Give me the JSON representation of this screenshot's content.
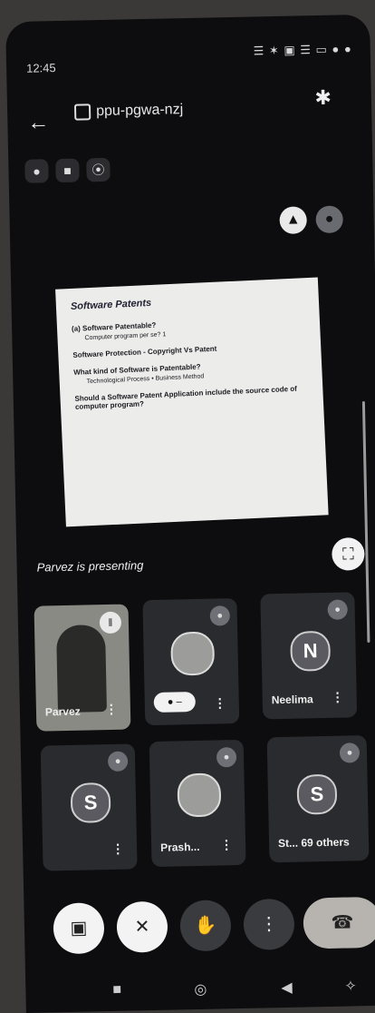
{
  "status": {
    "time": "12:45",
    "right_icons": "☰ ✶ ▣ ☰ ▭ ● ●"
  },
  "header": {
    "back_icon": "←",
    "meeting_code": "ppu-pgwa-nzj",
    "bluetooth_icon": "✱"
  },
  "chips": [
    "●",
    "■",
    "⦿"
  ],
  "top_actions": [
    "▲",
    "●"
  ],
  "slide": {
    "title": "Software Patents",
    "lines": [
      {
        "q": "(a) Software Patentable?",
        "a": "Computer program per se? 1"
      },
      {
        "q": "Software Protection - Copyright Vs Patent",
        "a": ""
      },
      {
        "q": "What kind of Software is Patentable?",
        "a": "Technological Process • Business Method"
      },
      {
        "q": "Should a Software Patent Application include the source code of computer program?",
        "a": ""
      }
    ]
  },
  "presenting_text": "Parvez is presenting",
  "fullscreen_icon": "⛶",
  "participants": [
    {
      "name": "Parvez",
      "type": "photo",
      "badge": "‖"
    },
    {
      "name": "",
      "type": "profile",
      "mic": "● –"
    },
    {
      "name": "Neelima",
      "initial": "N",
      "type": "initial"
    },
    {
      "name": "",
      "initial": "S",
      "type": "initial"
    },
    {
      "name": "Prash...",
      "type": "profile"
    },
    {
      "name": "St... 69 others",
      "initial": "S",
      "type": "initial"
    }
  ],
  "controls": {
    "present": "▣",
    "mic_off": "✕",
    "hand": "✋",
    "more": "⋮",
    "end": "☎"
  },
  "nav": {
    "recents": "■",
    "home": "◎",
    "back": "◀",
    "extra": "✧"
  }
}
